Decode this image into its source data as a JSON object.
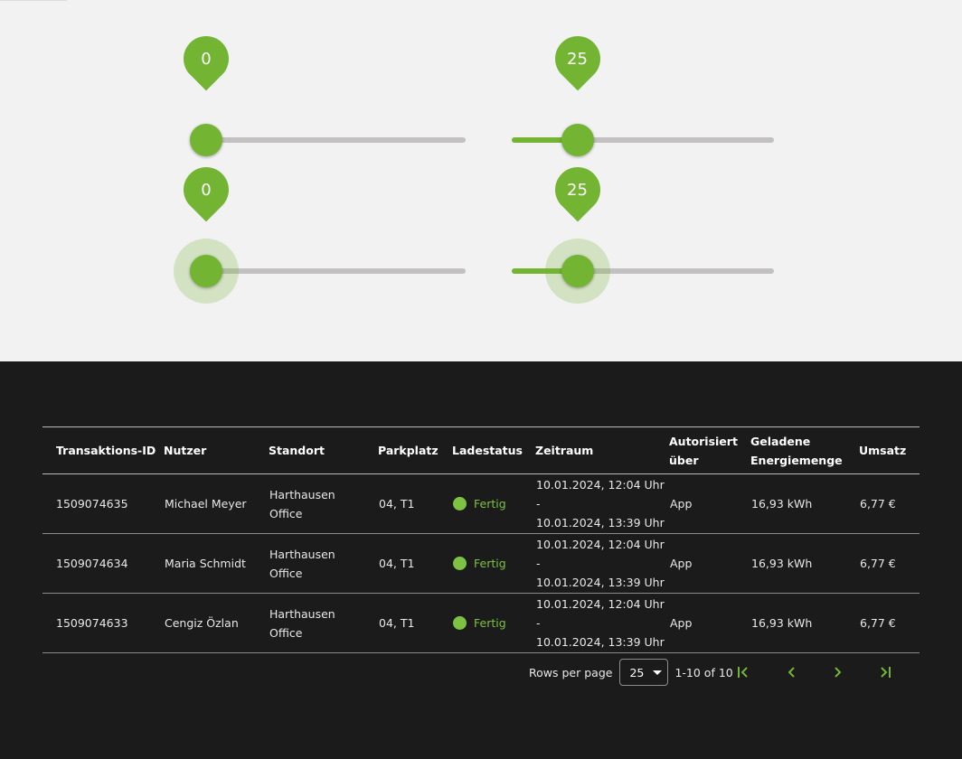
{
  "sliders": [
    {
      "value": 0,
      "label": "0",
      "max": 100,
      "focused": false
    },
    {
      "value": 25,
      "label": "25",
      "max": 100,
      "focused": false
    },
    {
      "value": 0,
      "label": "0",
      "max": 100,
      "focused": true
    },
    {
      "value": 25,
      "label": "25",
      "max": 100,
      "focused": true
    }
  ],
  "table": {
    "headers": {
      "id": "Transaktions-ID",
      "user": "Nutzer",
      "location": "Standort",
      "parking": "Parkplatz",
      "status": "Ladestatus",
      "period": "Zeitraum",
      "auth_line1": "Autorisiert",
      "auth_line2": "über",
      "energy_line1": "Geladene",
      "energy_line2": "Energiemenge",
      "revenue": "Umsatz"
    },
    "rows": [
      {
        "id": "1509074635",
        "user": "Michael Meyer",
        "loc1": "Harthausen",
        "loc2": "Office",
        "parking": "04, T1",
        "status": "Fertig",
        "time1": "10.01.2024, 12:04 Uhr -",
        "time2": "10.01.2024, 13:39 Uhr",
        "auth": "App",
        "energy": "16,93 kWh",
        "revenue": "6,77 €"
      },
      {
        "id": "1509074634",
        "user": "Maria Schmidt",
        "loc1": "Harthausen",
        "loc2": "Office",
        "parking": "04, T1",
        "status": "Fertig",
        "time1": "10.01.2024, 12:04 Uhr -",
        "time2": "10.01.2024, 13:39 Uhr",
        "auth": "App",
        "energy": "16,93 kWh",
        "revenue": "6,77 €"
      },
      {
        "id": "1509074633",
        "user": "Cengiz Özlan",
        "loc1": "Harthausen",
        "loc2": "Office",
        "parking": "04, T1",
        "status": "Fertig",
        "time1": "10.01.2024, 12:04 Uhr -",
        "time2": "10.01.2024, 13:39 Uhr",
        "auth": "App",
        "energy": "16,93 kWh",
        "revenue": "6,77 €"
      }
    ]
  },
  "pagination": {
    "rows_per_page_label": "Rows per page",
    "rows_per_page_value": "25",
    "range": "1-10 of 10",
    "icons": [
      "first-page-icon",
      "previous-page-icon",
      "next-page-icon",
      "last-page-icon"
    ]
  },
  "colors": {
    "accent": "#73b533",
    "status_done": "#7dc242",
    "light_bg": "#f2f2f2",
    "dark_bg": "#1b1b1b"
  }
}
